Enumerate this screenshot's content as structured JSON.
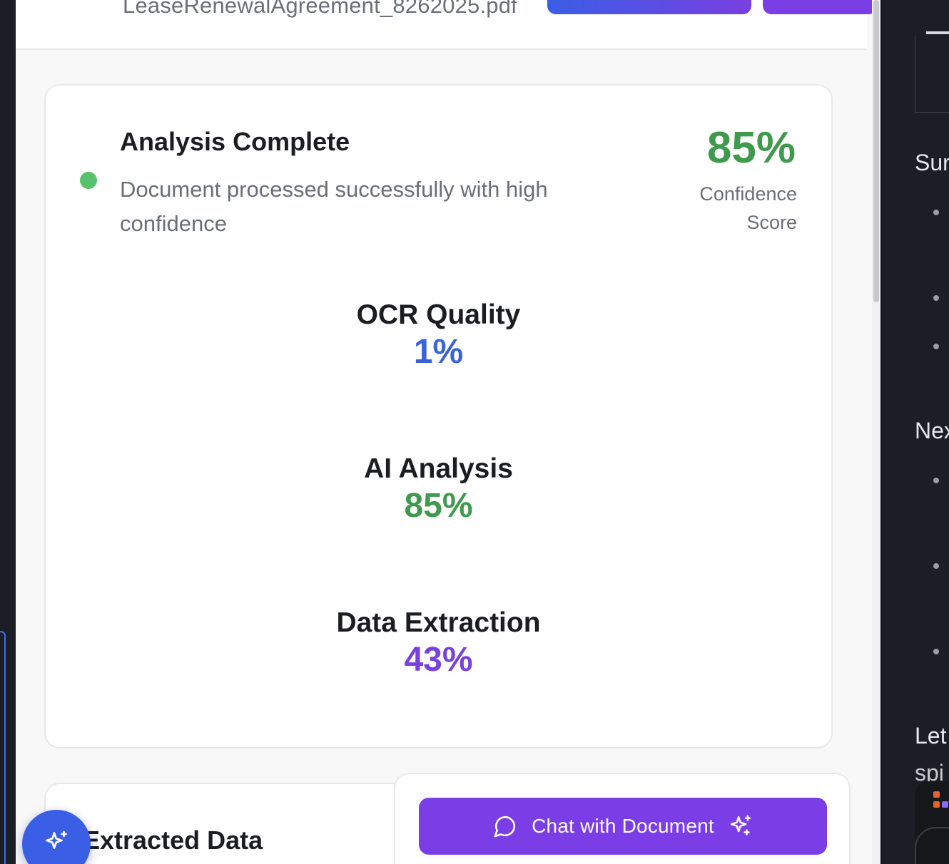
{
  "header": {
    "filename": "LeaseRenewalAgreement_8262025.pdf"
  },
  "analysis": {
    "title": "Analysis Complete",
    "subtitle": "Document processed successfully with high confidence",
    "confidence_value": "85%",
    "confidence_label": "Confidence Score",
    "status_color": "#56c26b"
  },
  "metrics": [
    {
      "label": "OCR Quality",
      "value": "1%",
      "color": "#3b63d9"
    },
    {
      "label": "AI Analysis",
      "value": "85%",
      "color": "#3f9a4d"
    },
    {
      "label": "Data Extraction",
      "value": "43%",
      "color": "#7a3fe0"
    }
  ],
  "extracted": {
    "title": "Extracted Data"
  },
  "chat": {
    "button_label": "Chat with Document",
    "left_icon": "chat-bubble-icon",
    "right_icon": "sparkles-icon",
    "color": "#7b3ee6"
  },
  "fab": {
    "icon": "sparkles-icon",
    "color": "#3a5ee6"
  },
  "side_panel": {
    "headings": [
      "Sur",
      "Nex",
      "Let",
      "spi"
    ]
  }
}
